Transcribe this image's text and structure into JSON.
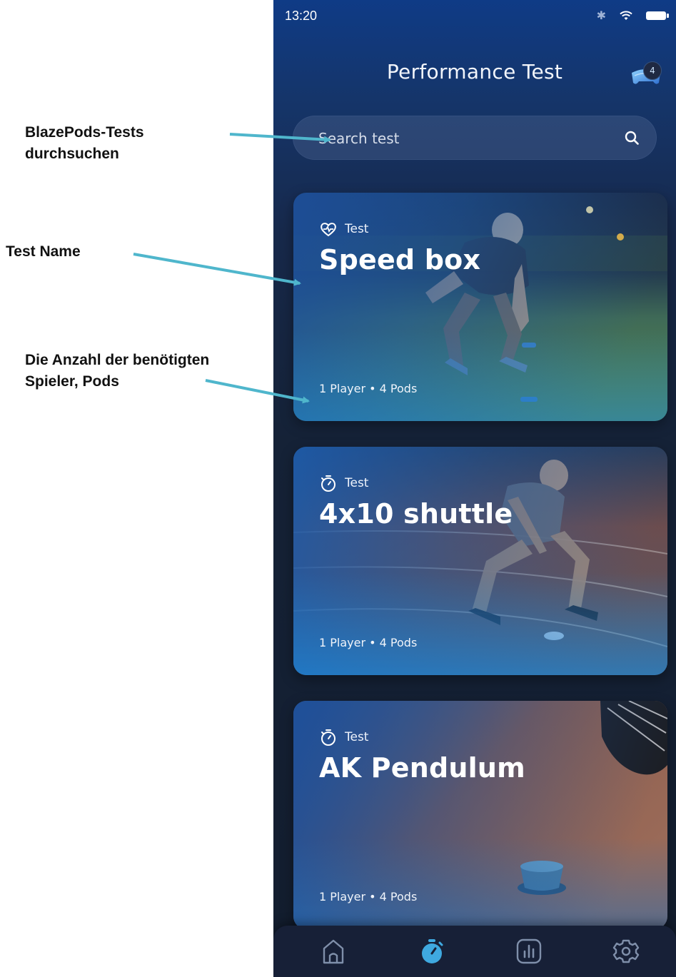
{
  "annotations": [
    {
      "text": "BlazePods-Tests\ndurchsuchen"
    },
    {
      "text": "Test Name"
    },
    {
      "text": "Die Anzahl der benötigten\nSpieler, Pods"
    }
  ],
  "status_bar": {
    "time": "13:20"
  },
  "header": {
    "title": "Performance Test",
    "pods_count": "4"
  },
  "search": {
    "placeholder": "Search test"
  },
  "cards": [
    {
      "tag": "Test",
      "tag_icon": "heart-pulse-icon",
      "title": "Speed box",
      "meta": "1 Player • 4 Pods"
    },
    {
      "tag": "Test",
      "tag_icon": "stopwatch-icon",
      "title": "4x10 shuttle",
      "meta": "1 Player • 4 Pods"
    },
    {
      "tag": "Test",
      "tag_icon": "stopwatch-icon",
      "title": "AK Pendulum",
      "meta": "1 Player • 4 Pods"
    }
  ],
  "bottom_nav": [
    {
      "icon": "home-icon"
    },
    {
      "icon": "stopwatch-icon",
      "active": true
    },
    {
      "icon": "bar-chart-icon"
    },
    {
      "icon": "gear-icon"
    }
  ],
  "colors": {
    "accent": "#3fa9e0",
    "annotation_arrow": "#4fb6cc",
    "background": "#131d2e"
  }
}
